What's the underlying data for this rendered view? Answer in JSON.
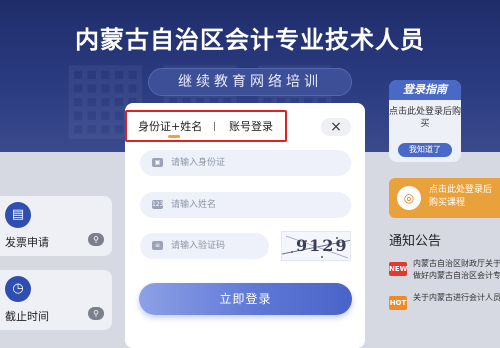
{
  "header": {
    "title": "内蒙古自治区会计专业技术人员",
    "subtitle": "继续教育网络培训"
  },
  "left_cards": [
    {
      "label": "发票申请",
      "icon": "invoice-icon"
    },
    {
      "label": "截止时间",
      "icon": "clock-icon"
    }
  ],
  "login_modal": {
    "tabs": [
      {
        "label": "身份证+姓名",
        "active": true
      },
      {
        "label": "账号登录",
        "active": false
      }
    ],
    "close_icon": "×",
    "fields": {
      "id_placeholder": "请输入身份证",
      "name_placeholder": "请输入姓名",
      "code_placeholder": "请输入验证码"
    },
    "captcha_text": "9129",
    "login_label": "立即登录",
    "accent_color": "#5e78d6",
    "highlight_color": "#e02222"
  },
  "guide": {
    "title": "登录指南",
    "text": "点击此处登录后购买",
    "button_label": "我知道了"
  },
  "buy_card": {
    "text": "点击此处登录后购买课程"
  },
  "notice": {
    "title": "通知公告",
    "items": [
      {
        "tag": "NEW",
        "tag_color": "#e23b2e",
        "text": "内蒙古自治区财政厅关于做好内蒙古自治区会计专业技术人员继续教育工作的通知"
      },
      {
        "tag": "HOT",
        "tag_color": "#f08a24",
        "text": "关于内蒙古进行会计人员继续教育"
      }
    ]
  }
}
